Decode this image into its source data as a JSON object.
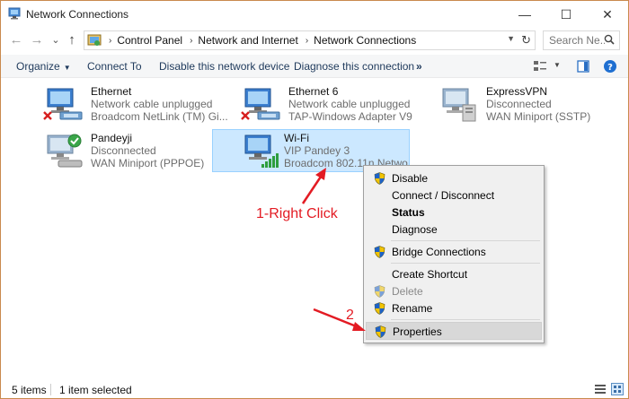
{
  "window": {
    "title": "Network Connections",
    "minimize_glyph": "—",
    "maximize_glyph": "☐",
    "close_glyph": "✕"
  },
  "address": {
    "back_glyph": "←",
    "forward_glyph": "→",
    "recent_glyph": "⌄",
    "up_glyph": "↑",
    "crumbs": [
      "Control Panel",
      "Network and Internet",
      "Network Connections"
    ],
    "search_placeholder": "Search Ne..."
  },
  "toolbar": {
    "organize": "Organize",
    "connect_to": "Connect To",
    "disable_device": "Disable this network device",
    "diagnose": "Diagnose this connection",
    "more": "»"
  },
  "connections": [
    {
      "name": "Ethernet",
      "status": "Network cable unplugged",
      "device": "Broadcom NetLink (TM) Gi...",
      "icon": "ethernet-icon",
      "badge": "red-x"
    },
    {
      "name": "Ethernet 6",
      "status": "Network cable unplugged",
      "device": "TAP-Windows Adapter V9",
      "icon": "ethernet-icon",
      "badge": "red-x"
    },
    {
      "name": "ExpressVPN",
      "status": "Disconnected",
      "device": "WAN Miniport (SSTP)",
      "icon": "vpn-icon",
      "badge": "none"
    },
    {
      "name": "Pandeyji",
      "status": "Disconnected",
      "device": "WAN Miniport (PPPOE)",
      "icon": "dialup-icon",
      "badge": "green-check"
    },
    {
      "name": "Wi-Fi",
      "status": "VIP Pandey 3",
      "device": "Broadcom 802.11n Networ",
      "icon": "wifi-icon",
      "badge": "signal-bars",
      "selected": true
    }
  ],
  "context_menu": {
    "items": [
      {
        "label": "Disable",
        "shield": true
      },
      {
        "label": "Connect / Disconnect",
        "shield": false
      },
      {
        "label": "Status",
        "shield": false,
        "bold": true
      },
      {
        "label": "Diagnose",
        "shield": false
      },
      {
        "label": "Bridge Connections",
        "shield": true
      },
      {
        "label": "Create Shortcut",
        "shield": false
      },
      {
        "label": "Delete",
        "shield": true,
        "disabled": true
      },
      {
        "label": "Rename",
        "shield": true
      },
      {
        "label": "Properties",
        "shield": true,
        "hover": true
      }
    ]
  },
  "annotations": {
    "step1": "1-Right Click",
    "step2": "2"
  },
  "status": {
    "item_count": "5 items",
    "selected_count": "1 item selected"
  },
  "colors": {
    "accent": "#0063b1",
    "annotation_red": "#e31b23",
    "selection_bg": "#cce8ff",
    "window_border": "#c98a4e"
  }
}
